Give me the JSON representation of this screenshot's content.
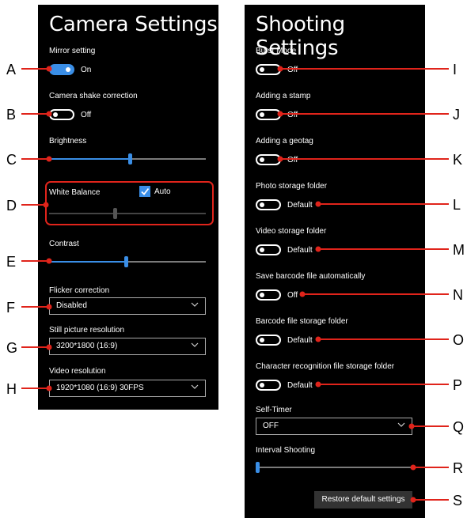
{
  "camera": {
    "title": "Camera Settings",
    "mirror_label": "Mirror setting",
    "mirror_state": "On",
    "shake_label": "Camera shake correction",
    "shake_state": "Off",
    "brightness_label": "Brightness",
    "brightness_level": 0.52,
    "wb_label": "White Balance",
    "wb_auto_label": "Auto",
    "wb_level": 0.42,
    "contrast_label": "Contrast",
    "contrast_level": 0.49,
    "flicker_label": "Flicker correction",
    "flicker_value": "Disabled",
    "still_label": "Still picture resolution",
    "still_value": "3200*1800 (16:9)",
    "video_label": "Video resolution",
    "video_value": "1920*1080 (16:9) 30FPS"
  },
  "shooting": {
    "title": "Shooting Settings",
    "burst_label": "Burst Mode",
    "burst_state": "Off",
    "stamp_label": "Adding a stamp",
    "stamp_state": "Off",
    "geotag_label": "Adding a geotag",
    "geotag_state": "Off",
    "photo_folder_label": "Photo storage folder",
    "photo_folder_state": "Default",
    "video_folder_label": "Video storage folder",
    "video_folder_state": "Default",
    "barcode_save_label": "Save barcode file automatically",
    "barcode_save_state": "Off",
    "barcode_folder_label": "Barcode file storage folder",
    "barcode_folder_state": "Default",
    "charrec_folder_label": "Character recognition file storage folder",
    "charrec_folder_state": "Default",
    "selftimer_label": "Self-Timer",
    "selftimer_value": "OFF",
    "interval_label": "Interval Shooting",
    "interval_level": 0.0,
    "restore_label": "Restore default settings"
  },
  "callouts": {
    "left": [
      "A",
      "B",
      "C",
      "D",
      "E",
      "F",
      "G",
      "H"
    ],
    "right": [
      "I",
      "J",
      "K",
      "L",
      "M",
      "N",
      "O",
      "P",
      "Q",
      "R",
      "S"
    ]
  },
  "colors": {
    "accent": "#3a8ee6",
    "callout_red": "#e0241b",
    "panel_bg": "#000000"
  }
}
